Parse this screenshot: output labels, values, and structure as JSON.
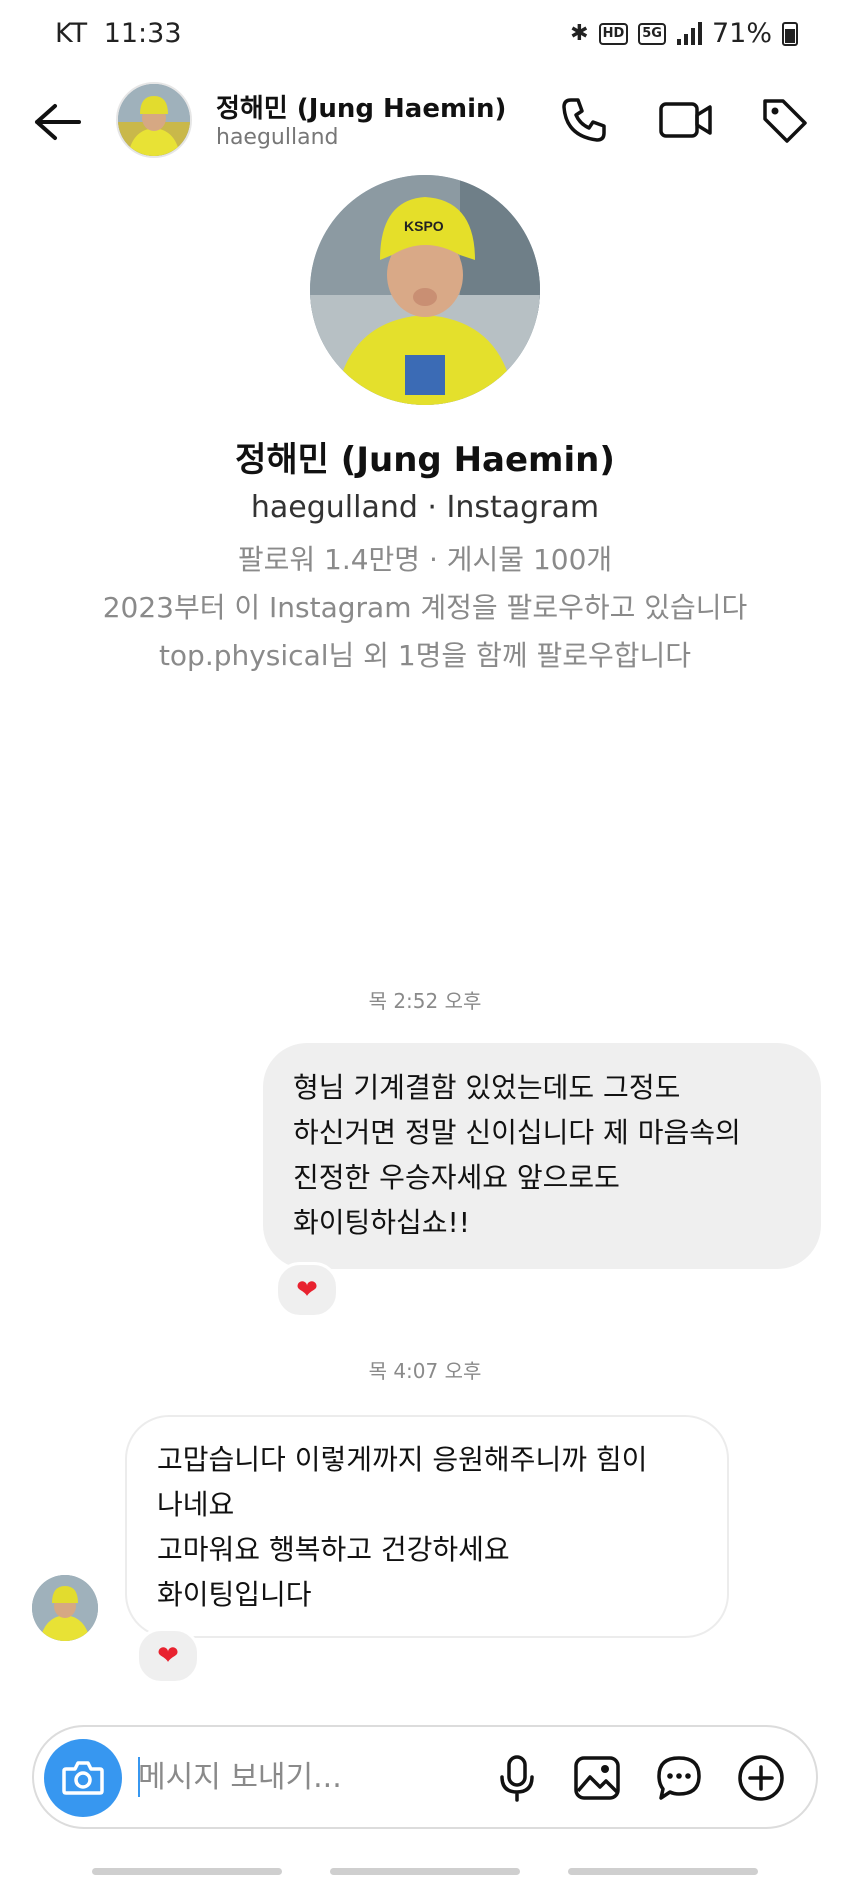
{
  "status_bar": {
    "carrier": "KT",
    "time": "11:33",
    "hd_label": "HD",
    "network_label": "5G",
    "battery": "71%"
  },
  "header": {
    "name": "정해민 (Jung Haemin)",
    "username": "haegulland"
  },
  "profile": {
    "name": "정해민 (Jung Haemin)",
    "subtitle": "haegulland · Instagram",
    "stats": "팔로워 1.4만명 · 게시물 100개",
    "follow_since": "2023부터 이 Instagram 계정을 팔로우하고 있습니다",
    "mutual": "top.physical님 외 1명을 함께 팔로우합니다"
  },
  "messages": [
    {
      "timestamp": "목 2:52 오후",
      "sender": "me",
      "lines": [
        "형님 기계결함 있었는데도 그정도",
        "하신거면 정말 신이십니다 제 마음속의",
        "진정한 우승자세요 앞으로도",
        "화이팅하십쇼!!"
      ],
      "reaction": "❤"
    },
    {
      "timestamp": "목 4:07 오후",
      "sender": "them",
      "lines": [
        "고맙습니다 이렇게까지 응원해주니까 힘이",
        "나네요",
        "고마워요 행복하고 건강하세요",
        "화이팅입니다"
      ],
      "reaction": "❤"
    }
  ],
  "composer": {
    "placeholder": "메시지 보내기..."
  },
  "icons": {
    "back": "back-arrow-icon",
    "call": "phone-icon",
    "video": "video-camera-icon",
    "tag": "tag-icon",
    "camera": "camera-icon",
    "mic": "microphone-icon",
    "gallery": "image-gallery-icon",
    "sticker": "chat-sticker-icon",
    "more": "plus-circle-icon"
  },
  "colors": {
    "accent": "#3797f0",
    "sent_bubble": "#efefef",
    "reaction_heart": "#e8222f",
    "muted_text": "#8a8a8a"
  }
}
